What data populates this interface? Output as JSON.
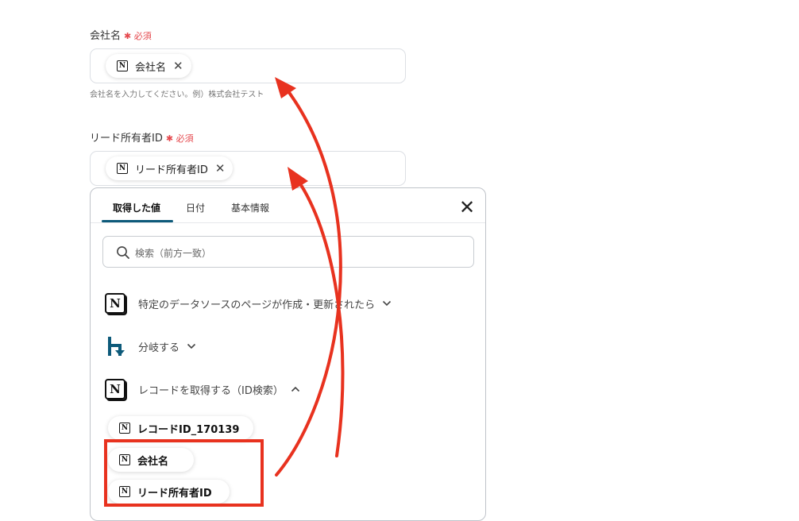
{
  "form": {
    "company": {
      "label": "会社名",
      "required": "必須",
      "chip": "会社名",
      "helper": "会社名を入力してください。例）株式会社テスト"
    },
    "owner": {
      "label": "リード所有者ID",
      "required": "必須",
      "chip": "リード所有者ID"
    }
  },
  "panel": {
    "tabs": [
      "取得した値",
      "日付",
      "基本情報"
    ],
    "active_tab": 0,
    "search_placeholder": "検索（前方一致）",
    "steps": [
      {
        "icon": "notion-icon",
        "label": "特定のデータソースのページが作成・更新されたら",
        "expanded": false
      },
      {
        "icon": "branch-icon",
        "label": "分岐する",
        "expanded": false
      },
      {
        "icon": "notion-icon",
        "label": "レコードを取得する（ID検索）",
        "expanded": true
      }
    ],
    "values": [
      "レコードID_170139",
      "会社名",
      "リード所有者ID"
    ]
  },
  "colors": {
    "accent": "#0d5a7a",
    "required": "#e5484d",
    "annotation": "#e8321f"
  }
}
